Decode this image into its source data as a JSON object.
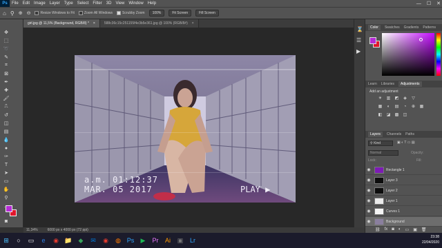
{
  "app": {
    "logo": "Ps"
  },
  "menu": [
    "File",
    "Edit",
    "Image",
    "Layer",
    "Type",
    "Select",
    "Filter",
    "3D",
    "View",
    "Window",
    "Help"
  ],
  "window_controls": {
    "minimize": "—",
    "maximize": "☐",
    "close": "✕"
  },
  "options": {
    "resize_windows": "Resize Windows to Fit",
    "zoom_all": "Zoom All Windows",
    "scrubby_zoom": "Scrubby Zoom",
    "zoom_100": "100%",
    "fit_screen": "Fit Screen",
    "fill_screen": "Fill Screen"
  },
  "tabs": [
    {
      "label": "girl.jpg @ 11,5% (Background, RGB/8) *",
      "close": "×"
    },
    {
      "label": "588c36c15c251155f4e3b5e361.jpg @ 100% (RGB/8#)",
      "close": "×"
    }
  ],
  "photo_overlay": {
    "time_line": "a.m. 01:12:37",
    "date_line": "MAR. 05 2017",
    "play": "PLAY",
    "play_symbol": "▶"
  },
  "status": {
    "zoom": "11,34%",
    "doc_info": "6000 px x 4000 px (72 ppi)"
  },
  "color_panel": {
    "tabs": [
      "Color",
      "Swatches",
      "Gradients",
      "Patterns"
    ],
    "fg_color": "#b62bd6",
    "bg_color": "#e1162c",
    "hue_color": "#c40bff"
  },
  "adjust_panel": {
    "tabs": [
      "Learn",
      "Libraries",
      "Adjustments"
    ],
    "add_label": "Add an adjustment",
    "icons_row1": [
      "☀",
      "▥",
      "◩",
      "◈",
      "▽"
    ],
    "icons_row2": [
      "▦",
      "◐",
      "▤",
      "◔",
      "⊕",
      "▦"
    ],
    "icons_row3": [
      "◧",
      "◪",
      "▩",
      "◫"
    ]
  },
  "layers_panel": {
    "tabs": [
      "Layers",
      "Channels",
      "Paths"
    ],
    "kind": "Kind",
    "mode": "Normal",
    "opacity_label": "Opacity:",
    "fill_label": "Fill:",
    "lock_label": "Lock:",
    "layers": [
      {
        "name": "Rectangle 1",
        "thumb": "#7d1bb5",
        "selected": false
      },
      {
        "name": "Layer 3",
        "thumb": "#0d0d0d",
        "selected": false
      },
      {
        "name": "Layer 2",
        "thumb": "#0d0d0d",
        "selected": false
      },
      {
        "name": "Layer 1",
        "thumb": "#eaeaea",
        "selected": false
      },
      {
        "name": "Curves 1",
        "thumb": "#f4f4f4",
        "selected": false
      },
      {
        "name": "Background",
        "thumb": "#8a7f9e",
        "selected": true
      }
    ],
    "footer_icons": [
      "⛓",
      "fx",
      "◙",
      "◐",
      "▭",
      "▣",
      "🗑"
    ]
  },
  "taskbar": {
    "icons": [
      "⊞",
      "○",
      "▭",
      "e",
      "◉",
      "📁",
      "◆",
      "✉",
      "◉",
      "◍",
      "Ps",
      "▶",
      "Pr",
      "Ai",
      "▣",
      "Lr"
    ]
  },
  "clock": {
    "time": "23:38",
    "date": "22/04/2020"
  }
}
